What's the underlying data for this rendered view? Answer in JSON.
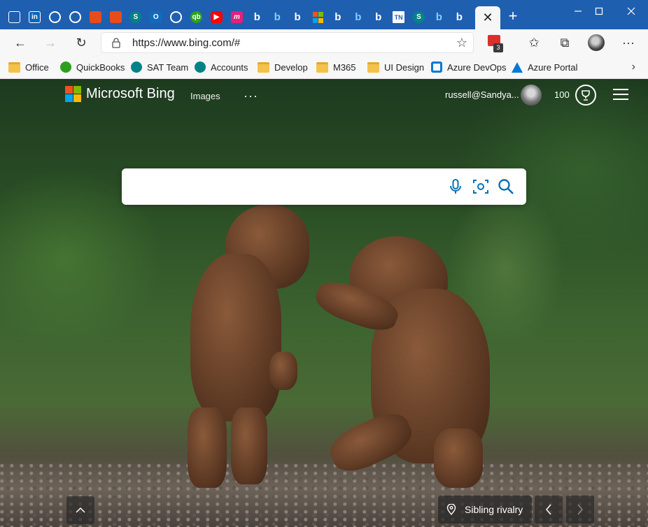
{
  "tabstrip": {
    "pinned_tabs": [
      {
        "icon": "window-icon"
      },
      {
        "icon": "linkedin-icon",
        "glyph": "in"
      },
      {
        "icon": "compass-icon"
      },
      {
        "icon": "compass-icon"
      },
      {
        "icon": "office-icon"
      },
      {
        "icon": "office-icon"
      },
      {
        "icon": "sharepoint-icon",
        "glyph": "S"
      },
      {
        "icon": "outlook-icon",
        "glyph": "O"
      },
      {
        "icon": "compass-icon"
      },
      {
        "icon": "quickbooks-icon",
        "glyph": "qb"
      },
      {
        "icon": "youtube-icon",
        "glyph": "▶"
      },
      {
        "icon": "m-icon",
        "glyph": "m"
      },
      {
        "icon": "bing-icon",
        "glyph": "b"
      },
      {
        "icon": "bing-icon",
        "glyph": "b"
      },
      {
        "icon": "bing-icon",
        "glyph": "b"
      },
      {
        "icon": "microsoft-icon"
      },
      {
        "icon": "bing-icon",
        "glyph": "b"
      },
      {
        "icon": "bing-icon",
        "glyph": "b"
      },
      {
        "icon": "bing-icon",
        "glyph": "b"
      },
      {
        "icon": "tn-icon",
        "glyph": "TN"
      },
      {
        "icon": "sharepoint-icon",
        "glyph": "S"
      },
      {
        "icon": "bing-icon",
        "glyph": "b"
      },
      {
        "icon": "bing-icon",
        "glyph": "b"
      }
    ],
    "active_tab_close": "✕",
    "new_tab": "+",
    "window_controls": {
      "minimize": "—",
      "maximize": "☐",
      "close": "✕"
    }
  },
  "toolbar": {
    "back": "←",
    "forward": "→",
    "refresh": "↻",
    "url": "https://www.bing.com/#",
    "favorite_add": "☆",
    "extension_badge": "3",
    "favorites": "✩",
    "collections": "⧉",
    "more": "···"
  },
  "favorites": [
    {
      "label": "Office",
      "icon": "folder-icon"
    },
    {
      "label": "QuickBooks",
      "icon": "quickbooks-icon"
    },
    {
      "label": "SAT Team",
      "icon": "sharepoint-icon"
    },
    {
      "label": "Accounts",
      "icon": "sharepoint-icon"
    },
    {
      "label": "Develop",
      "icon": "folder-icon"
    },
    {
      "label": "M365",
      "icon": "folder-icon"
    },
    {
      "label": "UI Design",
      "icon": "folder-icon"
    },
    {
      "label": "Azure DevOps",
      "icon": "azure-devops-icon"
    },
    {
      "label": "Azure Portal",
      "icon": "azure-icon"
    }
  ],
  "favorites_more": "›",
  "bing": {
    "brand": "Microsoft Bing",
    "nav_images": "Images",
    "nav_more": "···",
    "account": "russell@Sandya...",
    "points": "100",
    "search_placeholder": "",
    "image_caption": "Sibling rivalry"
  },
  "colors": {
    "tabstrip": "#1f5fb0",
    "toolbar": "#f7f7f7",
    "bing_accent": "#0a6fae",
    "ms_red": "#f25022",
    "ms_green": "#7fba00",
    "ms_blue": "#00a4ef",
    "ms_yellow": "#ffb900"
  }
}
